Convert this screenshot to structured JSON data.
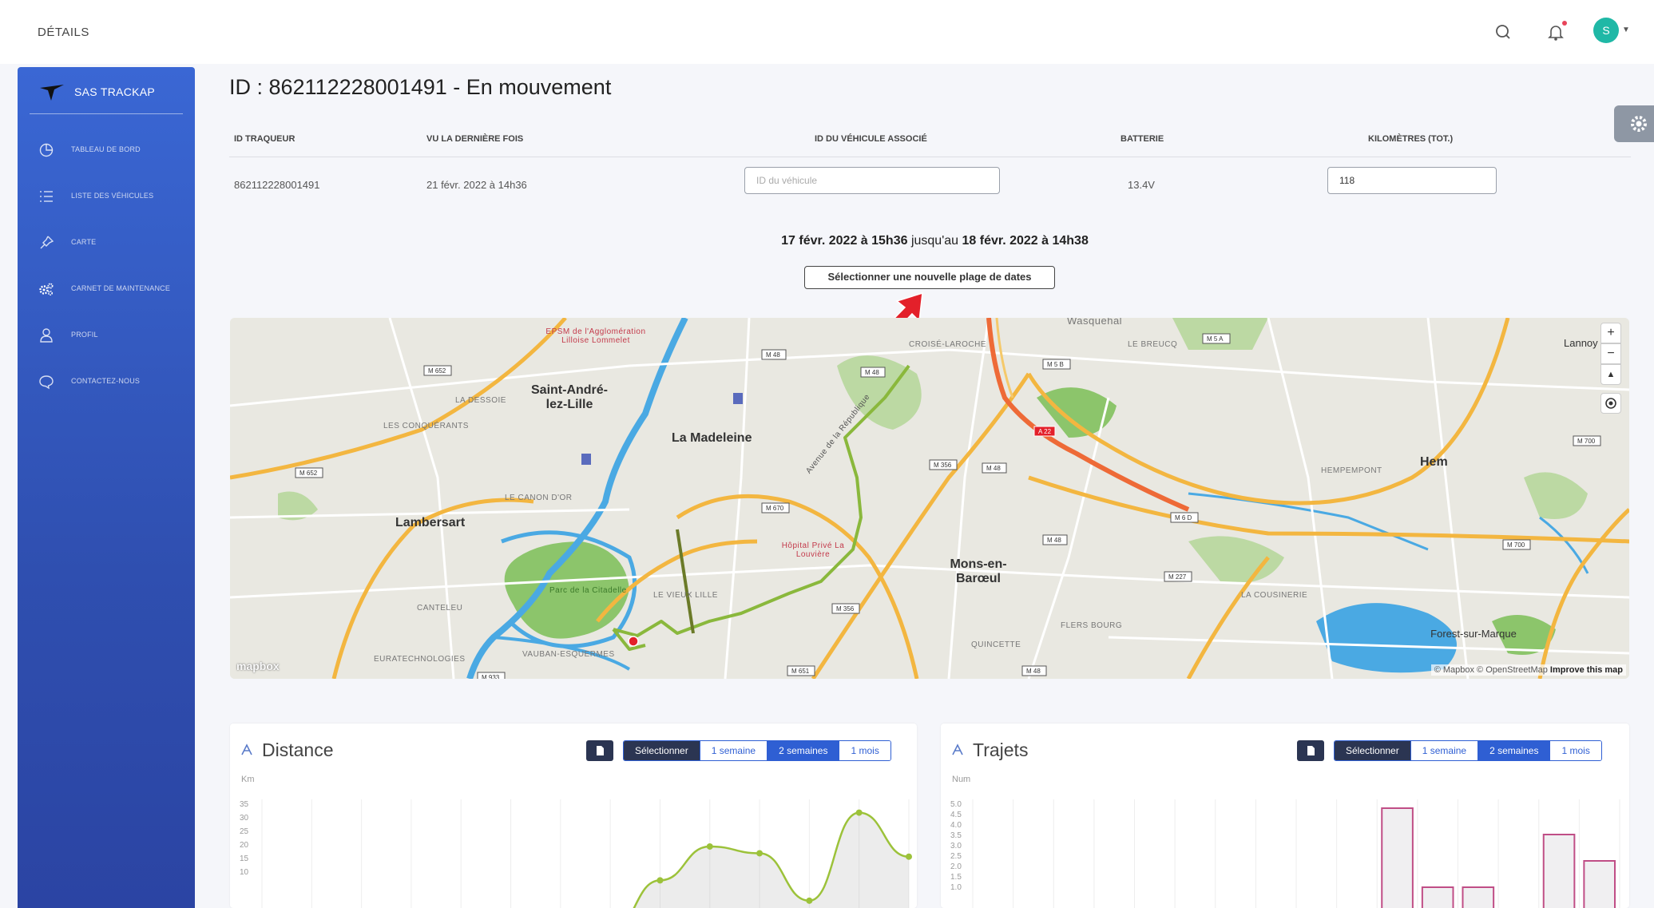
{
  "header": {
    "breadcrumb": "DÉTAILS",
    "avatar_letter": "S",
    "icons": [
      "search-icon",
      "bell-icon",
      "avatar"
    ]
  },
  "sidebar": {
    "brand": "SAS TRACKAP",
    "items": [
      {
        "label": "TABLEAU DE BORD",
        "icon": "dashboard-icon"
      },
      {
        "label": "LISTE DES VÉHICULES",
        "icon": "list-icon"
      },
      {
        "label": "CARTE",
        "icon": "pin-icon"
      },
      {
        "label": "CARNET DE MAINTENANCE",
        "icon": "gears-icon"
      },
      {
        "label": "PROFIL",
        "icon": "user-icon"
      },
      {
        "label": "CONTACTEZ-NOUS",
        "icon": "chat-icon"
      }
    ]
  },
  "page": {
    "title": "ID : 862112228001491 - En mouvement"
  },
  "table": {
    "headers": [
      "ID TRAQUEUR",
      "VU LA DERNIÈRE FOIS",
      "ID DU VÉHICULE ASSOCIÉ",
      "BATTERIE",
      "KILOMÈTRES (TOT.)"
    ],
    "row": {
      "tracker_id": "862112228001491",
      "last_seen": "21 févr. 2022 à 14h36",
      "vehicle_id_placeholder": "ID du véhicule",
      "battery": "13.4V",
      "km_total": "118"
    }
  },
  "range": {
    "start": "17 févr. 2022 à 15h36",
    "connector": " jusqu'au ",
    "end": "18 févr. 2022 à 14h38",
    "button": "Sélectionner une nouvelle plage de dates"
  },
  "map": {
    "places": [
      "Saint-André-lez-Lille",
      "La Madeleine",
      "Lambersart",
      "Mons-en-Barœul",
      "Hem",
      "Forest-sur-Marque",
      "Lannoy"
    ],
    "small_places": [
      "LA DESSOIE",
      "LES CONQUÉRANTS",
      "LE CANON D'OR",
      "CANTELEU",
      "EURATECHNOLOGIES",
      "VAUBAN-ESQUERMES",
      "LE VIEUX LILLE",
      "CROISÉ-LAROCHE",
      "LE BREUCQ",
      "HEMPEMPONT",
      "LA COUSINERIE",
      "FLERS BOURG",
      "QUINCETTE",
      "Wasquehal",
      "Parc de la Citadelle",
      "EPSM de l'Agglomération Lilloise Lommelet",
      "Hôpital Privé La Louvière",
      "Avenue de la République"
    ],
    "controls": [
      "+",
      "−",
      "▲"
    ],
    "logo": "mapbox",
    "attribution": "© Mapbox © OpenStreetMap",
    "improve": "Improve this map",
    "colors": {
      "route": "#8ab83c",
      "highway": "#f0a63a",
      "motorway": "#ee6a37",
      "water": "#4aa9e3",
      "park": "#8cc56b"
    }
  },
  "distance_panel": {
    "title": "Distance",
    "unit": "Km",
    "segments": [
      "Sélectionner",
      "1 semaine",
      "2 semaines",
      "1 mois"
    ],
    "active": "2 semaines",
    "yticks": [
      "35",
      "30",
      "25",
      "20",
      "15",
      "10"
    ]
  },
  "trips_panel": {
    "title": "Trajets",
    "unit": "Num",
    "segments": [
      "Sélectionner",
      "1 semaine",
      "2 semaines",
      "1 mois"
    ],
    "active": "2 semaines",
    "yticks": [
      "5.0",
      "4.5",
      "4.0",
      "3.5",
      "3.0",
      "2.5",
      "2.0",
      "1.5",
      "1.0"
    ]
  },
  "chart_data": [
    {
      "type": "area",
      "title": "Distance",
      "ylabel": "Km",
      "ylim": [
        0,
        38
      ],
      "visible_points": [
        [
          0,
          0
        ],
        [
          0,
          0
        ],
        [
          0,
          0
        ],
        [
          0,
          0
        ],
        [
          0,
          0
        ],
        [
          0,
          0
        ],
        [
          0,
          0
        ],
        [
          0,
          0
        ],
        [
          0,
          15
        ],
        [
          0,
          25
        ],
        [
          0,
          23
        ],
        [
          0,
          9
        ],
        [
          0,
          35
        ],
        [
          0,
          22
        ]
      ],
      "series": [
        {
          "values": [
            0,
            0,
            0,
            0,
            0,
            0,
            0,
            0,
            15,
            25,
            23,
            9,
            35,
            22
          ]
        }
      ]
    },
    {
      "type": "bar",
      "title": "Trajets",
      "ylabel": "Num",
      "ylim": [
        0,
        5
      ],
      "series": [
        {
          "values": [
            0,
            0,
            0,
            0,
            0,
            0,
            0,
            0,
            0,
            1,
            5,
            2,
            2,
            1,
            4,
            3
          ]
        }
      ]
    }
  ]
}
